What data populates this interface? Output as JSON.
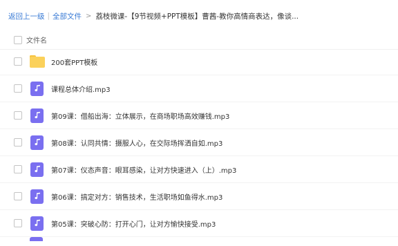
{
  "breadcrumb": {
    "back": "返回上一级",
    "all_files": "全部文件",
    "current": "荔枝微课-【9节视频+PPT模板】曹茜-教你高情商表达，像谈..."
  },
  "list": {
    "header_label": "文件名",
    "items": [
      {
        "name": "200套PPT模板",
        "type": "folder"
      },
      {
        "name": "课程总体介绍.mp3",
        "type": "audio"
      },
      {
        "name": "第09课：借船出海：立体展示，在商场职场高效赚钱.mp3",
        "type": "audio"
      },
      {
        "name": "第08课：认同共情：摄服人心，在交际场挥洒自如.mp3",
        "type": "audio"
      },
      {
        "name": "第07课：仪态声音：眼耳感染，让对方快速进入（上）.mp3",
        "type": "audio"
      },
      {
        "name": "第06课：搞定对方：销售技术，生活职场如鱼得水.mp3",
        "type": "audio"
      },
      {
        "name": "第05课：突破心防：打开心门，让对方愉快接受.mp3",
        "type": "audio"
      }
    ]
  },
  "colors": {
    "link": "#3a7bd5",
    "audio_icon": "#7a6ff0",
    "folder_icon": "#fbd15b"
  },
  "icons": {
    "folder": "folder-icon",
    "audio": "music-note-icon"
  }
}
